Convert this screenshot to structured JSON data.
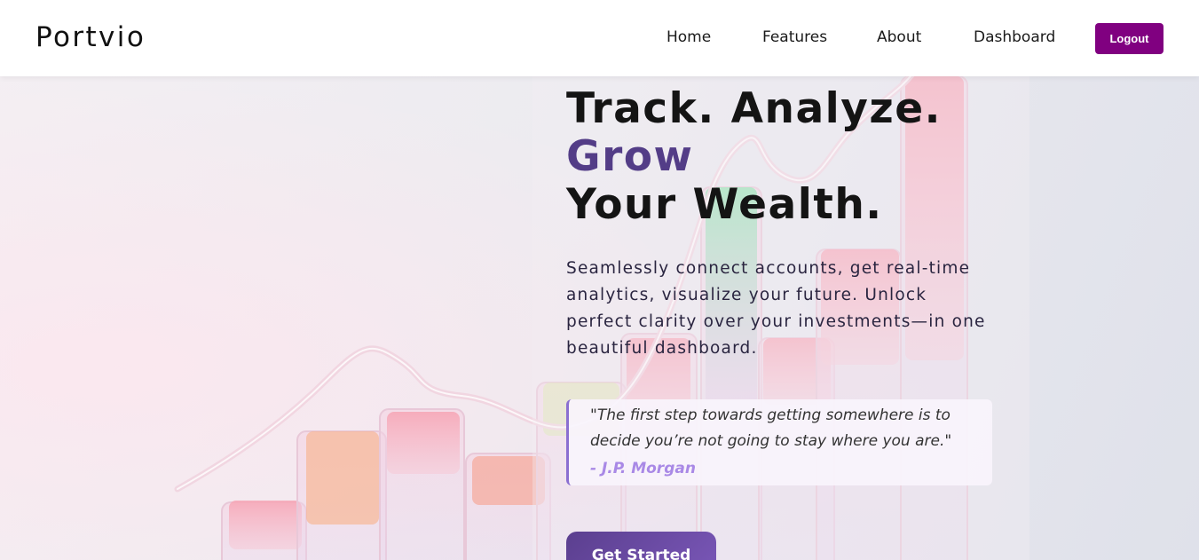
{
  "header": {
    "brand": "Portvio",
    "nav": [
      "Home",
      "Features",
      "About",
      "Dashboard"
    ],
    "logout_label": "Logout",
    "accent_color": "#800080"
  },
  "hero": {
    "line1": "Track. Analyze.",
    "line2": "Grow",
    "line3": "Your Wealth.",
    "accent_color": "#533d87",
    "description": "Seamlessly connect accounts, get real-time analytics, visualize your future. Unlock perfect clarity over your investments—in one beautiful dashboard.",
    "quote": "\"The first step towards getting somewhere is to decide you’re not going to stay where you are.\"",
    "quote_author": "- J.P. Morgan",
    "cta_label": "Get Started"
  },
  "background": {
    "illustration": "glass-bar-chart-illustration"
  }
}
